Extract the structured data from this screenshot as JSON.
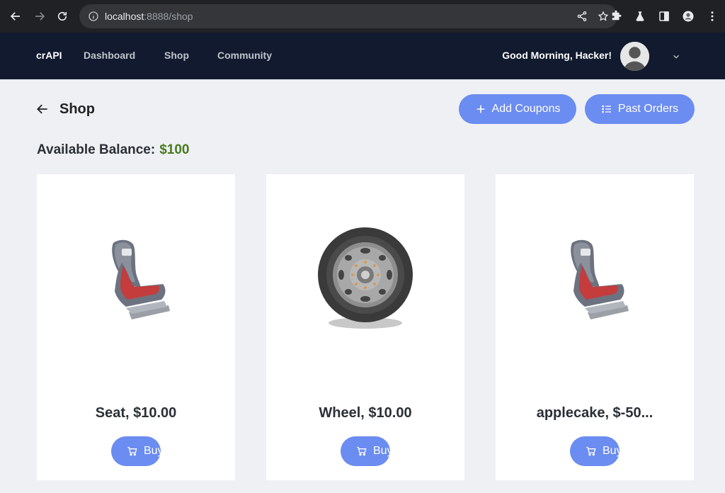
{
  "browser": {
    "url_host": "localhost",
    "url_rest": ":8888/shop"
  },
  "navbar": {
    "brand": "crAPI",
    "links": [
      "Dashboard",
      "Shop",
      "Community"
    ],
    "greeting": "Good Morning, Hacker!"
  },
  "page": {
    "title": "Shop",
    "add_coupons_label": "Add Coupons",
    "past_orders_label": "Past Orders",
    "balance_label": "Available Balance:",
    "balance_value": "$100"
  },
  "products": [
    {
      "name": "Seat, $10.00",
      "buy_label": "Buy",
      "icon": "car-seat-image"
    },
    {
      "name": "Wheel, $10.00",
      "buy_label": "Buy",
      "icon": "wheel-image"
    },
    {
      "name": "applecake, $-50...",
      "buy_label": "Buy",
      "icon": "car-seat-image"
    }
  ],
  "colors": {
    "accent": "#6b8cf0",
    "navbar": "#111a2e",
    "balance_value": "#4a7a1e"
  }
}
